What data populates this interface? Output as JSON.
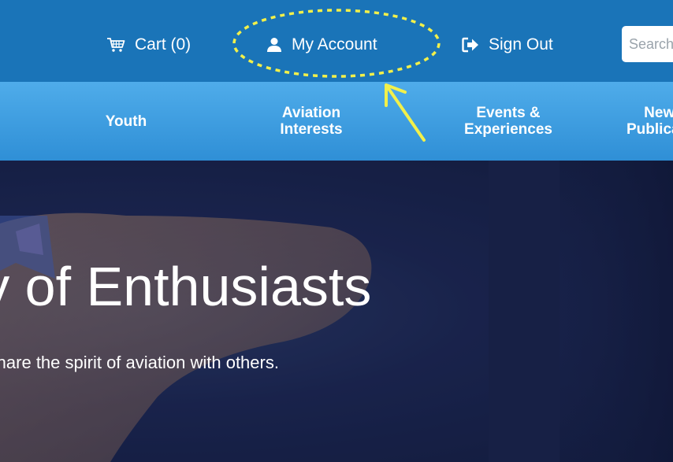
{
  "header": {
    "cart_label": "Cart (0)",
    "account_label": "My Account",
    "signout_label": "Sign Out",
    "search_placeholder": "Search"
  },
  "nav": {
    "items": [
      {
        "label": "Youth"
      },
      {
        "label": "Aviation\nInterests"
      },
      {
        "label": "Events &\nExperiences"
      },
      {
        "label": "News &\nPublications"
      }
    ]
  },
  "hero": {
    "title": "Join a Community of Enthusiasts",
    "subtitle": "Share the spirit of aviation with others."
  },
  "colors": {
    "topbar": "#1a74b8",
    "nav": "#3a9ae0",
    "hero": "#1c2550",
    "annotation": "#f2f04a"
  },
  "icons": {
    "cart": "shopping-cart-icon",
    "account": "user-icon",
    "signout": "sign-out-icon"
  }
}
